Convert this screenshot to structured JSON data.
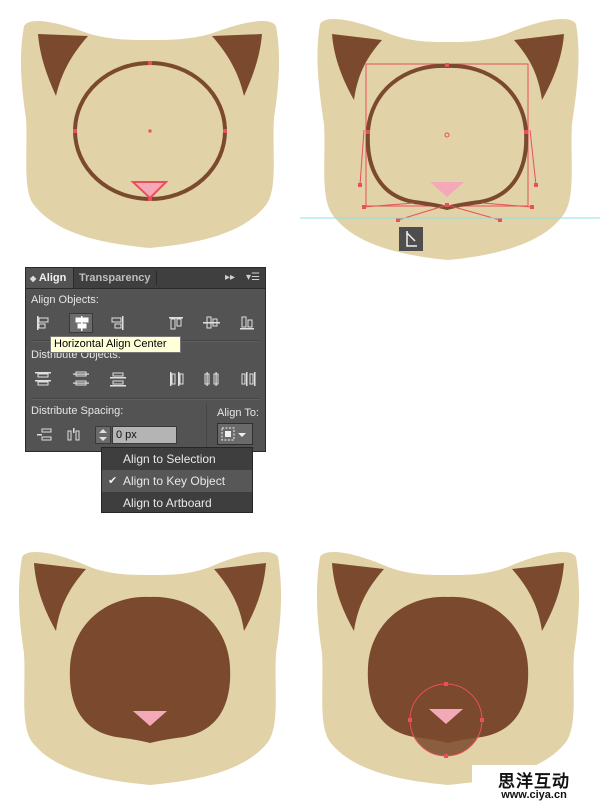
{
  "colors": {
    "fur": "#e2d2a8",
    "ear_inner": "#7b4a2e",
    "mask": "#7b4a2e",
    "nose": "#f4a9b8",
    "selection": "#e8505b",
    "guide": "#8fe0e6",
    "panel_bg": "#535353"
  },
  "align_panel": {
    "tabs": [
      "Align",
      "Transparency"
    ],
    "align_objects_label": "Align Objects:",
    "distribute_objects_label": "Distribute Objects:",
    "distribute_spacing_label": "Distribute Spacing:",
    "align_to_label": "Align To:",
    "spacing_value": "0 px",
    "icons": {
      "align_objects": [
        "horizontal-align-left-icon",
        "horizontal-align-center-icon",
        "horizontal-align-right-icon",
        "vertical-align-top-icon",
        "vertical-align-center-icon",
        "vertical-align-bottom-icon"
      ],
      "distribute_objects": [
        "vertical-distribute-top-icon",
        "vertical-distribute-center-icon",
        "vertical-distribute-bottom-icon",
        "horizontal-distribute-left-icon",
        "horizontal-distribute-center-icon",
        "horizontal-distribute-right-icon"
      ],
      "distribute_spacing": [
        "vertical-distribute-space-icon",
        "horizontal-distribute-space-icon"
      ]
    }
  },
  "tooltip": "Horizontal Align Center",
  "align_to_menu": {
    "items": [
      "Align to Selection",
      "Align to Key Object",
      "Align to Artboard"
    ],
    "checked_index": 1
  },
  "watermark": {
    "brand": "思洋互动",
    "url": "www.ciya.cn"
  }
}
